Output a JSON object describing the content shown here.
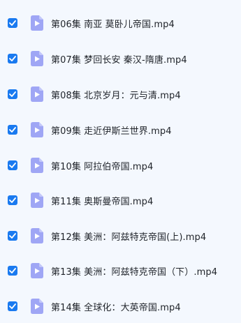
{
  "colors": {
    "background": "#f4f8fe",
    "checkbox": "#1a7af0",
    "video_icon": "#9fa6f5",
    "text": "#1f2329"
  },
  "files": [
    {
      "name": "第06集 南亚 莫卧儿帝国.mp4",
      "checked": true,
      "icon": "video-file-icon"
    },
    {
      "name": "第07集 梦回长安 秦汉-隋唐.mp4",
      "checked": true,
      "icon": "video-file-icon"
    },
    {
      "name": "第08集 北京岁月：元与清.mp4",
      "checked": true,
      "icon": "video-file-icon"
    },
    {
      "name": "第09集 走近伊斯兰世界.mp4",
      "checked": true,
      "icon": "video-file-icon"
    },
    {
      "name": "第10集 阿拉伯帝国.mp4",
      "checked": true,
      "icon": "video-file-icon"
    },
    {
      "name": "第11集 奥斯曼帝国.mp4",
      "checked": true,
      "icon": "video-file-icon"
    },
    {
      "name": "第12集 美洲：阿兹特克帝国(上).mp4",
      "checked": true,
      "icon": "video-file-icon"
    },
    {
      "name": "第13集 美洲：阿兹特克帝国（下）.mp4",
      "checked": true,
      "icon": "video-file-icon"
    },
    {
      "name": "第14集 全球化：大英帝国.mp4",
      "checked": true,
      "icon": "video-file-icon"
    }
  ]
}
